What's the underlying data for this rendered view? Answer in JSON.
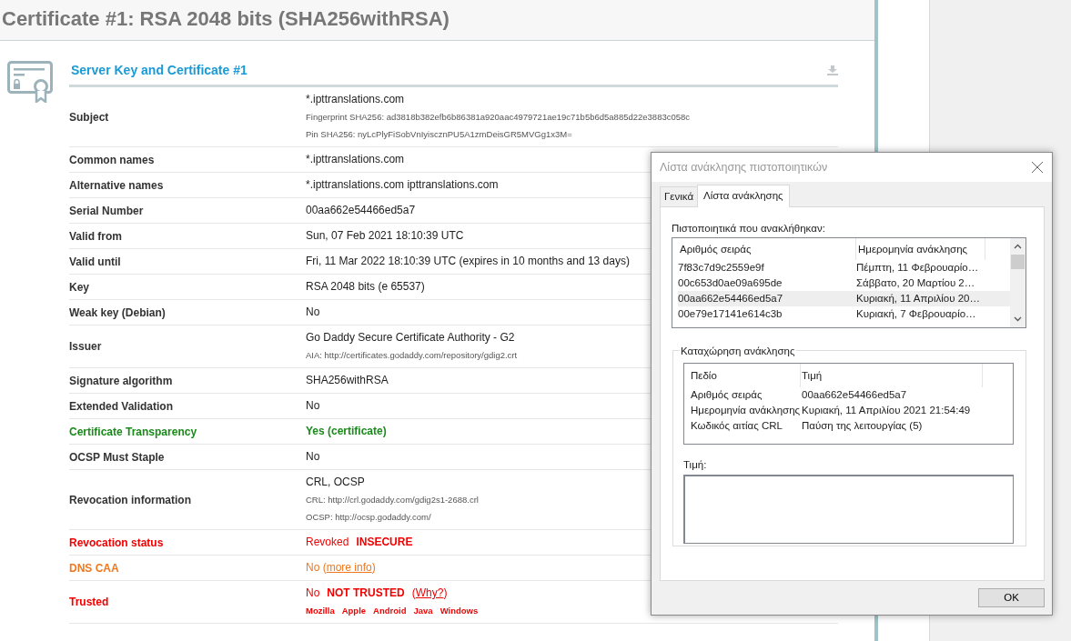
{
  "page_title": "Certificate #1: RSA 2048 bits (SHA256withRSA)",
  "section": {
    "title": "Server Key and Certificate #1",
    "rows": [
      {
        "label": "Subject",
        "lines": [
          {
            "kind": "main",
            "segments": [
              {
                "kind": "text",
                "text": "*.ipttranslations.com"
              }
            ]
          },
          {
            "kind": "sub",
            "segments": [
              {
                "kind": "text",
                "text": "Fingerprint SHA256: ad3818b382efb6b86381a920aac4979721ae19c71b5b6d5a885d22e3883c058c"
              }
            ]
          },
          {
            "kind": "sub",
            "segments": [
              {
                "kind": "text",
                "text": "Pin SHA256: nyLcPlyFiSobVnIyiscznPU5A1zmDeisGR5MVGg1x3M="
              }
            ]
          }
        ]
      },
      {
        "label": "Common names",
        "lines": [
          {
            "kind": "main",
            "segments": [
              {
                "kind": "text",
                "text": "*.ipttranslations.com"
              }
            ]
          }
        ]
      },
      {
        "label": "Alternative names",
        "lines": [
          {
            "kind": "main",
            "segments": [
              {
                "kind": "text",
                "text": "*.ipttranslations.com ipttranslations.com"
              }
            ]
          }
        ]
      },
      {
        "label": "Serial Number",
        "lines": [
          {
            "kind": "main",
            "segments": [
              {
                "kind": "text",
                "text": "00aa662e54466ed5a7"
              }
            ]
          }
        ]
      },
      {
        "label": "Valid from",
        "lines": [
          {
            "kind": "main",
            "segments": [
              {
                "kind": "text",
                "text": "Sun, 07 Feb 2021 18:10:39 UTC"
              }
            ]
          }
        ]
      },
      {
        "label": "Valid until",
        "lines": [
          {
            "kind": "main",
            "segments": [
              {
                "kind": "text",
                "text": "Fri, 11 Mar 2022 18:10:39 UTC (expires in 10 months and 13 days)"
              }
            ]
          }
        ]
      },
      {
        "label": "Key",
        "lines": [
          {
            "kind": "main",
            "segments": [
              {
                "kind": "text",
                "text": "RSA 2048 bits (e 65537)"
              }
            ]
          }
        ]
      },
      {
        "label": "Weak key (Debian)",
        "lines": [
          {
            "kind": "main",
            "segments": [
              {
                "kind": "text",
                "text": "No"
              }
            ]
          }
        ]
      },
      {
        "label": "Issuer",
        "lines": [
          {
            "kind": "main",
            "segments": [
              {
                "kind": "text",
                "text": "Go Daddy Secure Certificate Authority - G2"
              }
            ]
          },
          {
            "kind": "sub",
            "segments": [
              {
                "kind": "text",
                "text": "AIA: http://certificates.godaddy.com/repository/gdig2.crt"
              }
            ]
          }
        ]
      },
      {
        "label": "Signature algorithm",
        "lines": [
          {
            "kind": "main",
            "segments": [
              {
                "kind": "text",
                "text": "SHA256withRSA"
              }
            ]
          }
        ]
      },
      {
        "label": "Extended Validation",
        "lines": [
          {
            "kind": "main",
            "segments": [
              {
                "kind": "text",
                "text": "No"
              }
            ]
          }
        ]
      },
      {
        "label": "Certificate Transparency",
        "color": "#1a8a1a",
        "lines": [
          {
            "kind": "main",
            "segments": [
              {
                "kind": "strong",
                "text": "Yes (certificate)"
              }
            ]
          }
        ]
      },
      {
        "label": "OCSP Must Staple",
        "lines": [
          {
            "kind": "main",
            "segments": [
              {
                "kind": "text",
                "text": "No"
              }
            ]
          }
        ]
      },
      {
        "label": "Revocation information",
        "lines": [
          {
            "kind": "main",
            "segments": [
              {
                "kind": "text",
                "text": "CRL, OCSP"
              }
            ]
          },
          {
            "kind": "sub",
            "segments": [
              {
                "kind": "text",
                "text": "CRL: http://crl.godaddy.com/gdig2s1-2688.crl"
              }
            ]
          },
          {
            "kind": "sub",
            "segments": [
              {
                "kind": "text",
                "text": "OCSP: http://ocsp.godaddy.com/"
              }
            ]
          }
        ]
      },
      {
        "label": "Revocation status",
        "color": "#f20000",
        "lines": [
          {
            "kind": "main",
            "segments": [
              {
                "kind": "text",
                "text": "Revoked"
              },
              {
                "kind": "strong",
                "text": "INSECURE"
              }
            ]
          }
        ]
      },
      {
        "label": "DNS CAA",
        "color": "#f07820",
        "lines": [
          {
            "kind": "main",
            "segments": [
              {
                "kind": "link",
                "before": "No (",
                "text": "more info",
                "after": ")"
              }
            ]
          }
        ]
      },
      {
        "label": "Trusted",
        "color": "#f20000",
        "lines": [
          {
            "kind": "main",
            "segments": [
              {
                "kind": "text",
                "text": "No"
              },
              {
                "kind": "strong",
                "text": "NOT TRUSTED"
              },
              {
                "kind": "link",
                "before": "(",
                "text": "Why?",
                "after": ")"
              }
            ]
          },
          {
            "kind": "tags",
            "segments": [
              {
                "kind": "strong",
                "text": "Mozilla"
              },
              {
                "kind": "strong",
                "text": "Apple"
              },
              {
                "kind": "strong",
                "text": "Android"
              },
              {
                "kind": "strong",
                "text": "Java"
              },
              {
                "kind": "strong",
                "text": "Windows"
              }
            ]
          }
        ]
      }
    ]
  },
  "dialog": {
    "title": "Λίστα ανάκλησης πιστοποιητικών",
    "tabs": [
      {
        "label": "Γενικά",
        "selected": false
      },
      {
        "label": "Λίστα ανάκλησης",
        "selected": true
      }
    ],
    "list_label": "Πιστοποιητικά που ανακλήθηκαν:",
    "list_columns": [
      "Αριθμός σειράς",
      "Ημερομηνία ανάκλησης"
    ],
    "list_rows": [
      {
        "serial": "7f83c7d9c2559e9f",
        "date": "Πέμπτη, 11 Φεβρουαρίο…",
        "selected": false
      },
      {
        "serial": "00c653d0ae09a695de",
        "date": "Σάββατο, 20 Μαρτίου 2…",
        "selected": false
      },
      {
        "serial": "00aa662e54466ed5a7",
        "date": "Κυριακή, 11 Απριλίου 20…",
        "selected": true
      },
      {
        "serial": "00e79e17141e614c3b",
        "date": "Κυριακή, 7 Φεβρουαρίο…",
        "selected": false
      }
    ],
    "group_title": "Καταχώρηση ανάκλησης",
    "detail_columns": [
      "Πεδίο",
      "Τιμή"
    ],
    "detail_rows": [
      {
        "field": "Αριθμός σειράς",
        "value": "00aa662e54466ed5a7"
      },
      {
        "field": "Ημερομηνία ανάκλησης",
        "value": "Κυριακή, 11 Απριλίου 2021 21:54:49"
      },
      {
        "field": "Κωδικός αιτίας CRL",
        "value": "Παύση της λειτουργίας (5)"
      }
    ],
    "value_label": "Τιμή:",
    "ok_button": "OK"
  }
}
